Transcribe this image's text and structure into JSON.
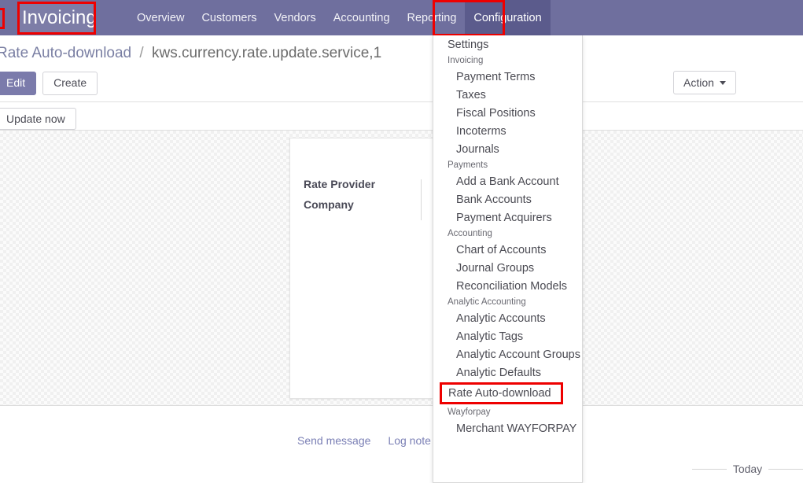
{
  "navbar": {
    "brand": "Invoicing",
    "links": [
      {
        "label": "Overview",
        "active": false
      },
      {
        "label": "Customers",
        "active": false
      },
      {
        "label": "Vendors",
        "active": false
      },
      {
        "label": "Accounting",
        "active": false
      },
      {
        "label": "Reporting",
        "active": false
      },
      {
        "label": "Configuration",
        "active": true
      }
    ],
    "accent_color": "#6f6f9e",
    "active_color": "#5b5b8c",
    "highlight_color": "#ee0000"
  },
  "breadcrumb": {
    "previous": "Rate Auto-download",
    "separator": "/",
    "current": "kws.currency.rate.update.service,1"
  },
  "toolbar": {
    "edit_label": "Edit",
    "create_label": "Create",
    "action_label": "Action",
    "action_icon": "chevron-down-icon"
  },
  "statusbar": {
    "update_now_label": "Update now"
  },
  "form": {
    "fields": [
      {
        "label": "Rate Provider",
        "value": ""
      },
      {
        "label": "Company",
        "value": ""
      }
    ]
  },
  "chatter": {
    "send_message_label": "Send message",
    "log_note_label": "Log note",
    "today_label": "Today"
  },
  "dropdown": {
    "entries": [
      {
        "type": "item",
        "label": "Settings"
      },
      {
        "type": "section",
        "label": "Invoicing"
      },
      {
        "type": "sub",
        "label": "Payment Terms"
      },
      {
        "type": "sub",
        "label": "Taxes"
      },
      {
        "type": "sub",
        "label": "Fiscal Positions"
      },
      {
        "type": "sub",
        "label": "Incoterms"
      },
      {
        "type": "sub",
        "label": "Journals"
      },
      {
        "type": "section",
        "label": "Payments"
      },
      {
        "type": "sub",
        "label": "Add a Bank Account"
      },
      {
        "type": "sub",
        "label": "Bank Accounts"
      },
      {
        "type": "sub",
        "label": "Payment Acquirers"
      },
      {
        "type": "section",
        "label": "Accounting"
      },
      {
        "type": "sub",
        "label": "Chart of Accounts"
      },
      {
        "type": "sub",
        "label": "Journal Groups"
      },
      {
        "type": "sub",
        "label": "Reconciliation Models"
      },
      {
        "type": "section",
        "label": "Analytic Accounting"
      },
      {
        "type": "sub",
        "label": "Analytic Accounts"
      },
      {
        "type": "sub",
        "label": "Analytic Tags"
      },
      {
        "type": "sub",
        "label": "Analytic Account Groups"
      },
      {
        "type": "sub",
        "label": "Analytic Defaults"
      },
      {
        "type": "highlight",
        "label": "Rate Auto-download"
      },
      {
        "type": "section",
        "label": "Wayforpay"
      },
      {
        "type": "sub",
        "label": "Merchant WAYFORPAY"
      }
    ]
  }
}
